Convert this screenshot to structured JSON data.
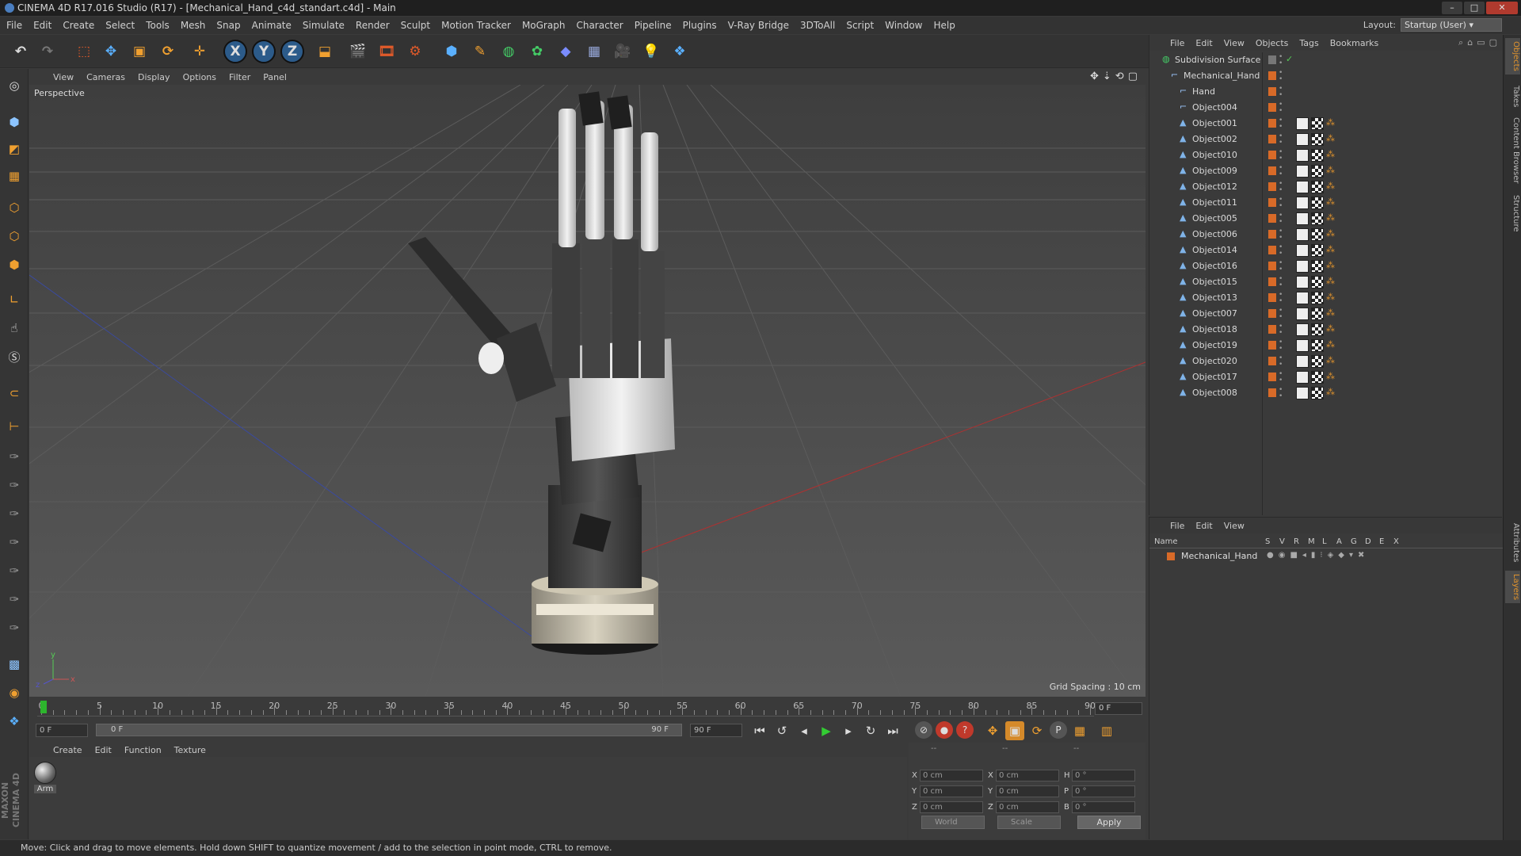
{
  "window": {
    "title": "CINEMA 4D R17.016 Studio (R17) - [Mechanical_Hand_c4d_standart.c4d] - Main"
  },
  "menu": [
    "File",
    "Edit",
    "Create",
    "Select",
    "Tools",
    "Mesh",
    "Snap",
    "Animate",
    "Simulate",
    "Render",
    "Sculpt",
    "Motion Tracker",
    "MoGraph",
    "Character",
    "Pipeline",
    "Plugins",
    "V-Ray Bridge",
    "3DToAll",
    "Script",
    "Window",
    "Help"
  ],
  "layout": {
    "label": "Layout:",
    "value": "Startup (User)"
  },
  "toolbar": {
    "axis_x": "X",
    "axis_y": "Y",
    "axis_z": "Z"
  },
  "viewport": {
    "menu": [
      "View",
      "Cameras",
      "Display",
      "Options",
      "Filter",
      "Panel"
    ],
    "label": "Perspective",
    "grid_spacing": "Grid Spacing : 10 cm"
  },
  "timeline": {
    "ticks": [
      "0",
      "5",
      "10",
      "15",
      "20",
      "25",
      "30",
      "35",
      "40",
      "45",
      "50",
      "55",
      "60",
      "65",
      "70",
      "75",
      "80",
      "85",
      "90"
    ],
    "current_frame": "0 F",
    "start_field": "0 F",
    "scrub_start": "0 F",
    "scrub_end": "90 F",
    "end_field": "90 F"
  },
  "material": {
    "menu": [
      "Create",
      "Edit",
      "Function",
      "Texture"
    ],
    "items": [
      {
        "name": "Arm"
      }
    ]
  },
  "coords": {
    "headers": [
      "--",
      "--",
      "--"
    ],
    "rows": [
      {
        "a": "X",
        "av": "0 cm",
        "b": "X",
        "bv": "0 cm",
        "c": "H",
        "cv": "0 °"
      },
      {
        "a": "Y",
        "av": "0 cm",
        "b": "Y",
        "bv": "0 cm",
        "c": "P",
        "cv": "0 °"
      },
      {
        "a": "Z",
        "av": "0 cm",
        "b": "Z",
        "bv": "0 cm",
        "c": "B",
        "cv": "0 °"
      }
    ],
    "mode": "World",
    "transform": "Scale",
    "apply": "Apply"
  },
  "objects": {
    "menu": [
      "File",
      "Edit",
      "View",
      "Objects",
      "Tags",
      "Bookmarks"
    ],
    "items": [
      {
        "name": "Subdivision Surface",
        "depth": 0,
        "type": "subdiv"
      },
      {
        "name": "Mechanical_Hand",
        "depth": 1,
        "type": "null"
      },
      {
        "name": "Hand",
        "depth": 2,
        "type": "null"
      },
      {
        "name": "Object004",
        "depth": 2,
        "type": "null"
      },
      {
        "name": "Object001",
        "depth": 2,
        "type": "mesh"
      },
      {
        "name": "Object002",
        "depth": 2,
        "type": "mesh"
      },
      {
        "name": "Object010",
        "depth": 2,
        "type": "mesh"
      },
      {
        "name": "Object009",
        "depth": 2,
        "type": "mesh"
      },
      {
        "name": "Object012",
        "depth": 2,
        "type": "mesh"
      },
      {
        "name": "Object011",
        "depth": 2,
        "type": "mesh"
      },
      {
        "name": "Object005",
        "depth": 2,
        "type": "mesh"
      },
      {
        "name": "Object006",
        "depth": 2,
        "type": "mesh"
      },
      {
        "name": "Object014",
        "depth": 2,
        "type": "mesh"
      },
      {
        "name": "Object016",
        "depth": 2,
        "type": "mesh"
      },
      {
        "name": "Object015",
        "depth": 2,
        "type": "mesh"
      },
      {
        "name": "Object013",
        "depth": 2,
        "type": "mesh"
      },
      {
        "name": "Object007",
        "depth": 2,
        "type": "mesh"
      },
      {
        "name": "Object018",
        "depth": 2,
        "type": "mesh"
      },
      {
        "name": "Object019",
        "depth": 2,
        "type": "mesh"
      },
      {
        "name": "Object020",
        "depth": 2,
        "type": "mesh"
      },
      {
        "name": "Object017",
        "depth": 2,
        "type": "mesh"
      },
      {
        "name": "Object008",
        "depth": 2,
        "type": "mesh"
      }
    ]
  },
  "layers": {
    "menu": [
      "File",
      "Edit",
      "View"
    ],
    "columns": [
      "Name",
      "S",
      "V",
      "R",
      "M",
      "L",
      "A",
      "G",
      "D",
      "E",
      "X"
    ],
    "items": [
      {
        "name": "Mechanical_Hand",
        "color": "#d86a28"
      }
    ]
  },
  "right_tabs": [
    "Objects",
    "Takes",
    "Content Browser",
    "Structure",
    "Attributes",
    "Layers"
  ],
  "status": "Move: Click and drag to move elements. Hold down SHIFT to quantize movement / add to the selection in point mode, CTRL to remove.",
  "colors": {
    "accent": "#d86a28",
    "playhead": "#2db52d",
    "selection_blue": "#2c5b8a"
  }
}
